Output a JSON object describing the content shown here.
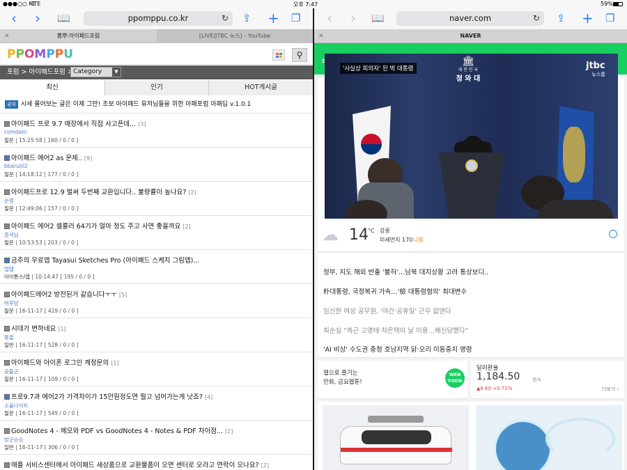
{
  "status": {
    "carrier": "●●●○○ KT",
    "network": "LTE",
    "time": "오후 7:47",
    "battery": "59%"
  },
  "left": {
    "url": "ppomppu.co.kr",
    "tabs": [
      {
        "label": "뽐뿌:아이패드포럼",
        "active": true
      },
      {
        "label": "[LIVE/JTBC 뉴스] - YouTube",
        "active": false
      }
    ],
    "logo": "PPOMPPU",
    "breadcrumb": "포럼 > 아이패드포럼 >",
    "category": "Category",
    "board_tabs": [
      "최신",
      "인기",
      "HOT게시글"
    ],
    "notice": {
      "badge": "공지",
      "text": "시세 물어보는 글은 이제 그만! 초보 아이패드 유저님들을 위한 아패포럼 아패딥 v.1.0.1"
    },
    "posts": [
      {
        "title": "아이패드 프로 9.7 매장에서 직접 사고픈데...",
        "count": "[3]",
        "author": "comdain",
        "cat": "질문",
        "meta": "15:25:58 [ 160 / 0 / 0 ]"
      },
      {
        "title": "아이패드 에어2 as 문제..",
        "count": "[9]",
        "author": "bbanzili2",
        "cat": "질문",
        "meta": "14:18:12 [ 177 / 0 / 0 ]"
      },
      {
        "title": "아이패드프로 12.9 벌써 두번째 교환입니다.. 불량률이 높나요?",
        "count": "[2]",
        "author": "순영",
        "cat": "질문",
        "meta": "12:49:06 [ 157 / 0 / 0 ]"
      },
      {
        "title": "아이패드 에어2 셀룰러 64기가 얼마 정도 주고 사면 좋을까요",
        "count": "[2]",
        "author": "증석님",
        "cat": "질문",
        "meta": "10:53:53 [ 203 / 0 / 0 ]"
      },
      {
        "title": "금주의 무료앱 Tayasui Sketches Pro (아이패드 스케치 그림앱)...",
        "count": "",
        "author": "업앱",
        "cat": "아이튠스/앱",
        "meta": "10:14:47 [ 195 / 0 / 0 ]"
      },
      {
        "title": "아이패드에어2 방전된거 같습니다ㅜㅜ",
        "count": "[5]",
        "author": "머루당",
        "cat": "질문",
        "meta": "16-11-17 [ 419 / 0 / 0 ]"
      },
      {
        "title": "시대가 변하네요",
        "count": "[1]",
        "author": "뚱꼴",
        "cat": "일반",
        "meta": "16-11-17 [ 528 / 0 / 0 ]"
      },
      {
        "title": "아이패드와 아이폰 로그인 계정문의",
        "count": "[1]",
        "author": "곰돌군",
        "cat": "질문",
        "meta": "16-11-17 [ 109 / 0 / 0 ]"
      },
      {
        "title": "프로9.7과 에어2가 가격차이가 15만원정도면 뭘고 넘어가는게 낫죠?",
        "count": "[4]",
        "author": "소울나이트",
        "cat": "질문",
        "meta": "16-11-17 [ 549 / 0 / 0 ]"
      },
      {
        "title": "GoodNotes 4 - 메모와 PDF vs GoodNotes 4 - Notes & PDF 차이점...",
        "count": "[2]",
        "author": "방군승승",
        "cat": "일반",
        "meta": "16-11-17 [ 306 / 0 / 0 ]"
      },
      {
        "title": "애플 서비스센터에서 아이패드 새상품으로 교환물품이 오면 센터로 오라고 연락이 오나요?",
        "count": "[2]",
        "author": "",
        "cat": "",
        "meta": ""
      }
    ]
  },
  "right": {
    "url": "naver.com",
    "tab": "NAVER",
    "video": {
      "caption": "'사실상 피의자' 된 박 대통령",
      "seal_top": "대 한 민 국",
      "seal_name": "청 와 대",
      "channel": "jtbc",
      "channel_sub": "뉴스룸"
    },
    "weather": {
      "temp": "14",
      "unit": "°C",
      "location": "강릉",
      "dust_label": "미세먼지 170",
      "dust_level": "나쁨"
    },
    "news": [
      {
        "text": "정부, 지도 해외 반출 '불허'…남북 대치상황 고려 통상보디..",
        "gray": false
      },
      {
        "text": "朴대통령, 국정복귀 가속…'檢 대통령혐의' 최대변수",
        "gray": false
      },
      {
        "text": "임신한 여성 공무원, '야간·공휴일' 근무 없앤다",
        "gray": true
      },
      {
        "text": "최순실 \"측근 고영태·차은택이 날 이용…배신당했다\"",
        "gray": true
      },
      {
        "text": "'AI 비상' 수도권 충청 호남지역 닭·오리 이동중지 명령",
        "gray": false
      }
    ],
    "webtoon": {
      "line1": "웹으로 즐기는",
      "line2": "만화, 금요웹툰!",
      "logo1": "WEB",
      "logo2": "TOON"
    },
    "fx": {
      "label": "달러환율",
      "value": "1,184.50",
      "unit": "원/$",
      "change": "▲8.60 +0.72%",
      "more": "더보기 ›"
    }
  },
  "colors": {
    "accent": "#2f7cf6",
    "naver_green": "#19ce60",
    "video_bg": "#1d2a4a"
  }
}
